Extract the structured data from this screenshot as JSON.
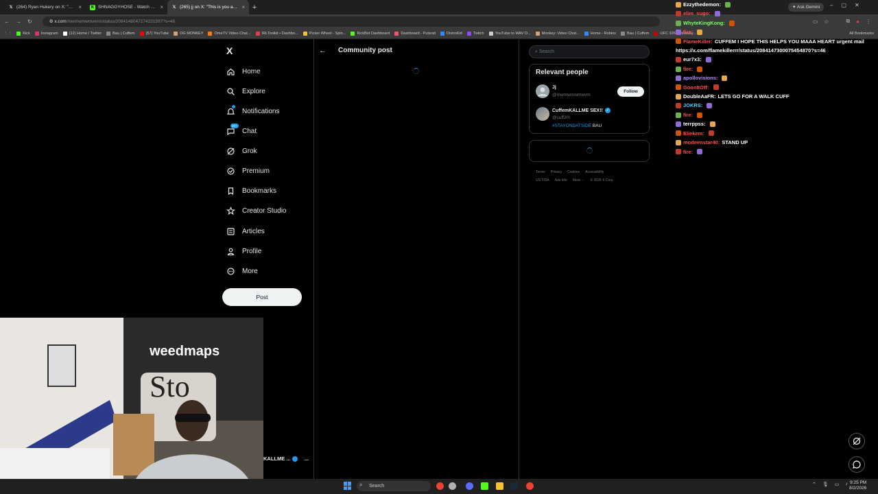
{
  "browser": {
    "tabs": [
      {
        "label": "(264) Ryan Hukery on X: \"Kick c",
        "icon": "x-icon",
        "active": false
      },
      {
        "label": "SHNAGGYHOSE - Watch clips c",
        "icon": "kick-icon",
        "active": false
      },
      {
        "label": "(265) jj on X: \"This is you and y",
        "icon": "x-icon",
        "active": true
      }
    ],
    "new_tab": "+",
    "ask_gemini": "Ask Gemini",
    "url_host": "x.com",
    "url_path": "/mwmwmwmwvm/status/2084148047274221597?s=46",
    "bookmarks": [
      {
        "label": "Kick",
        "color": "#53fc18"
      },
      {
        "label": "Instagram",
        "color": "#e1306c"
      },
      {
        "label": "(12) Home / Twitter",
        "color": "#ffffff"
      },
      {
        "label": "Bau | Cuffem",
        "color": "#888888"
      },
      {
        "label": "(57) YouTube",
        "color": "#ff0000"
      },
      {
        "label": "OG MONKEY",
        "color": "#d4a373"
      },
      {
        "label": "OmeTV Video Chat...",
        "color": "#ff7a00"
      },
      {
        "label": "IRLToolkit • Dashbo...",
        "color": "#e63946"
      },
      {
        "label": "Picker Wheel - Spin...",
        "color": "#f4c430"
      },
      {
        "label": "KickBot Dashboard",
        "color": "#53fc18"
      },
      {
        "label": "Dashboard - Pulsoid",
        "color": "#ff4d6d"
      },
      {
        "label": "DistroKid",
        "color": "#3a86ff"
      },
      {
        "label": "Twitch",
        "color": "#9146ff"
      },
      {
        "label": "YouTube to WAV D...",
        "color": "#cccccc"
      },
      {
        "label": "Monkey: Video Chat...",
        "color": "#d4a373"
      },
      {
        "label": "Home - Roblox",
        "color": "#3a86ff"
      },
      {
        "label": "Bau | Cuffem",
        "color": "#888888"
      },
      {
        "label": "UFC 326: Holloway...",
        "color": "#d00000"
      }
    ],
    "all_bookmarks": "All Bookmarks"
  },
  "sidebar": {
    "logo": "X",
    "items": [
      {
        "label": "Home",
        "icon": "home-icon"
      },
      {
        "label": "Explore",
        "icon": "search-icon"
      },
      {
        "label": "Notifications",
        "icon": "bell-icon"
      },
      {
        "label": "Chat",
        "icon": "chat-icon",
        "badge": "20+"
      },
      {
        "label": "Grok",
        "icon": "grok-icon"
      },
      {
        "label": "Premium",
        "icon": "premium-icon"
      },
      {
        "label": "Bookmarks",
        "icon": "bookmark-icon"
      },
      {
        "label": "Creator Studio",
        "icon": "creator-studio-icon"
      },
      {
        "label": "Articles",
        "icon": "articles-icon"
      },
      {
        "label": "Profile",
        "icon": "profile-icon"
      },
      {
        "label": "More",
        "icon": "more-icon"
      }
    ],
    "post_button": "Post",
    "account_name": "KALLME ...",
    "account_more": "..."
  },
  "main": {
    "back": "←",
    "title": "Community post"
  },
  "right": {
    "search_placeholder": "Search",
    "relevant_title": "Relevant people",
    "people": [
      {
        "name": "Jj",
        "handle": "@mwmwmwmwvm",
        "follow": "Follow"
      },
      {
        "name": "CuffemKALLME SEX!!",
        "handle": "@cuff3m",
        "hashtag": "#STAYONDATSIDE",
        "bio_rest": " BAU"
      }
    ],
    "footer_line1": [
      "Terms",
      "Privacy",
      "Cookies",
      "Accessibility"
    ],
    "footer_line2": [
      "US TIDA",
      "Ads info",
      "More ···",
      "© 2026 X Corp."
    ]
  },
  "chat": [
    {
      "user": "Ezzythedemon:",
      "color": "#ffffff",
      "msg": ""
    },
    {
      "user": "elim_sugo:",
      "color": "#ff4d4d",
      "msg": ""
    },
    {
      "user": "WhyteKingKong:",
      "color": "#7cff6b",
      "msg": ""
    },
    {
      "user": "fire:",
      "color": "#ff4d4d",
      "msg": ""
    },
    {
      "user": "FlameKiller:",
      "color": "#ff4d4d",
      "msg": "CUFFEM I HOPE THIS HELPS YOU MAAA HEART urgent mail"
    },
    {
      "user": "",
      "color": "#ffffff",
      "msg": "https://x.com/flamekillerrr/status/2084147300075454870?s=46"
    },
    {
      "user": "eur7x3:",
      "color": "#ffffff",
      "msg": ""
    },
    {
      "user": "fire:",
      "color": "#ff4d4d",
      "msg": ""
    },
    {
      "user": "apollovisions:",
      "color": "#b48cff",
      "msg": ""
    },
    {
      "user": "GoonItOff:",
      "color": "#ff4d4d",
      "msg": ""
    },
    {
      "user": "DoubleAaFR:",
      "color": "#ffffff",
      "msg": "LETS GO FOR A WALK CUFF"
    },
    {
      "user": "JOKRS:",
      "color": "#4dd2ff",
      "msg": ""
    },
    {
      "user": "fire:",
      "color": "#ff4d4d",
      "msg": ""
    },
    {
      "user": "terrppss:",
      "color": "#ffffff",
      "msg": ""
    },
    {
      "user": "Eliekem:",
      "color": "#ff4d4d",
      "msg": ""
    },
    {
      "user": "modeenstar40:",
      "color": "#ff4d4d",
      "msg": "STAND UP"
    },
    {
      "user": "fire:",
      "color": "#ff4d4d",
      "msg": ""
    }
  ],
  "webcam": {
    "banner_text": "weedmaps",
    "sign_text": "Sto"
  },
  "taskbar": {
    "search": "Search",
    "time": "9:25 PM",
    "date": "8/2/2026"
  }
}
